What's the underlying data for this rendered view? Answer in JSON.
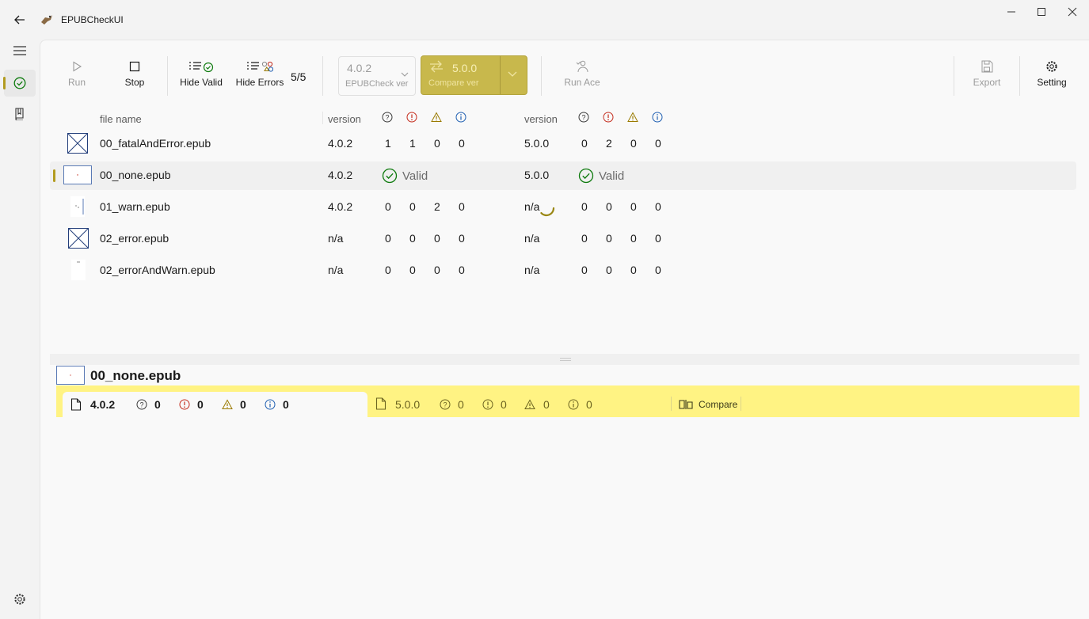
{
  "window": {
    "title": "EPUBCheckUI"
  },
  "toolbar": {
    "run_label": "Run",
    "stop_label": "Stop",
    "hide_valid_label": "Hide Valid",
    "hide_errors_label": "Hide Errors",
    "count": "5/5",
    "epubcheck_ver": {
      "value": "4.0.2",
      "label": "EPUBCheck ver"
    },
    "compare_ver": {
      "value": "5.0.0",
      "label": "Compare ver"
    },
    "run_ace_label": "Run Ace",
    "export_label": "Export",
    "setting_label": "Setting"
  },
  "table": {
    "headers": {
      "file_name": "file name",
      "version_a": "version",
      "version_b": "version"
    },
    "rows": [
      {
        "name": "00_fatalAndError.epub",
        "ver_a": "4.0.2",
        "a": [
          "1",
          "1",
          "0",
          "0"
        ],
        "ver_b": "5.0.0",
        "b": [
          "0",
          "2",
          "0",
          "0"
        ]
      },
      {
        "name": "00_none.epub",
        "ver_a": "4.0.2",
        "a_valid": "Valid",
        "ver_b": "5.0.0",
        "b_valid": "Valid"
      },
      {
        "name": "01_warn.epub",
        "ver_a": "4.0.2",
        "a": [
          "0",
          "0",
          "2",
          "0"
        ],
        "ver_b": "n/a",
        "b": [
          "0",
          "0",
          "0",
          "0"
        ]
      },
      {
        "name": "02_error.epub",
        "ver_a": "n/a",
        "a": [
          "0",
          "0",
          "0",
          "0"
        ],
        "ver_b": "n/a",
        "b": [
          "0",
          "0",
          "0",
          "0"
        ]
      },
      {
        "name": "02_errorAndWarn.epub",
        "ver_a": "n/a",
        "a": [
          "0",
          "0",
          "0",
          "0"
        ],
        "ver_b": "n/a",
        "b": [
          "0",
          "0",
          "0",
          "0"
        ]
      }
    ]
  },
  "detail": {
    "title": "00_none.epub",
    "tab_a": {
      "version": "4.0.2",
      "counts": [
        "0",
        "0",
        "0",
        "0"
      ]
    },
    "tab_b": {
      "version": "5.0.0",
      "counts": [
        "0",
        "0",
        "0",
        "0"
      ]
    },
    "compare_label": "Compare"
  },
  "colors": {
    "accent": "#b29b1f",
    "compare_button": "#c8b84c",
    "tab_strip": "#fff383",
    "fatal": "#3a3a3a",
    "error": "#c42b1c",
    "warning": "#9a7a00",
    "info": "#1f5fb2",
    "valid": "#0f7b0f"
  }
}
